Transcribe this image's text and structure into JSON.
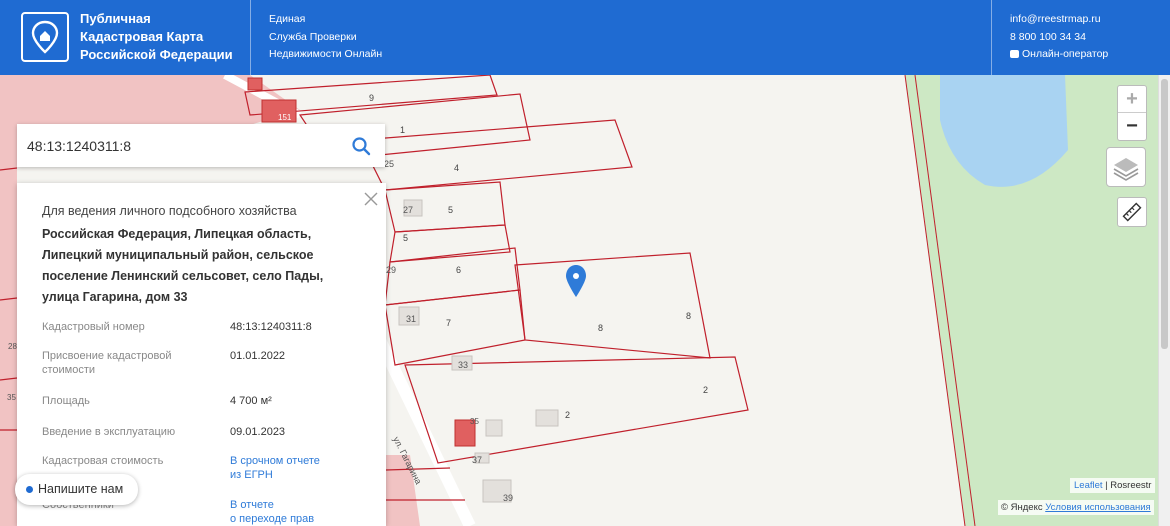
{
  "header": {
    "title_lines": [
      "Публичная",
      "Кадастровая Карта",
      "Российской Федерации"
    ],
    "service_lines": [
      "Единая",
      "Служба Проверки",
      "Недвижимости Онлайн"
    ],
    "email": "info@rreestrmap.ru",
    "phone": "8 800 100 34 34",
    "operator": "Онлайн-оператор",
    "colors": {
      "header_bg": "#1f6bd2",
      "parcel_border": "#c0202c",
      "link": "#2f7bd8"
    }
  },
  "search": {
    "value": "48:13:1240311:8",
    "icon": "search-icon"
  },
  "info": {
    "purpose": "Для ведения личного подсобного хозяйства",
    "address_lines": [
      "Российская Федерация, Липецкая область,",
      "Липецкий муниципальный район, сельское",
      "поселение Ленинский сельсовет, село Пады,",
      "улица Гагарина, дом 33"
    ],
    "rows": [
      {
        "key_lines": [
          "Кадастровый номер"
        ],
        "value_lines": [
          "48:13:1240311:8"
        ],
        "is_link": false
      },
      {
        "key_lines": [
          "Присвоение кадастровой",
          "стоимости"
        ],
        "value_lines": [
          "01.01.2022"
        ],
        "is_link": false
      },
      {
        "key_lines": [
          "Площадь"
        ],
        "value_lines": [
          "4 700 м²"
        ],
        "is_link": false
      },
      {
        "key_lines": [
          "Введение в эксплуатацию"
        ],
        "value_lines": [
          "09.01.2023"
        ],
        "is_link": false
      },
      {
        "key_lines": [
          "Кадастровая стоимость"
        ],
        "value_lines": [
          "В срочном отчете",
          "из ЕГРН"
        ],
        "is_link": true
      },
      {
        "key_lines": [
          "Собственники"
        ],
        "value_lines": [
          "В отчете",
          "о переходе прав"
        ],
        "is_link": true
      }
    ]
  },
  "chat_button": "Напишите нам",
  "map": {
    "parcel_labels": [
      "9",
      "1",
      "4",
      "5",
      "5",
      "6",
      "7",
      "8",
      "8",
      "2",
      "2"
    ],
    "building_labels": [
      "151",
      "25",
      "27",
      "29",
      "31",
      "33",
      "35",
      "37",
      "39",
      "28",
      "35"
    ],
    "street_label": "ул. Гагарина",
    "zoom_in": "+",
    "zoom_out": "−"
  },
  "attribution": {
    "leaflet": "Leaflet",
    "separator": " | ",
    "rosreestr": "Rosreestr",
    "copyright": "© Яндекс",
    "terms": "Условия использования"
  }
}
